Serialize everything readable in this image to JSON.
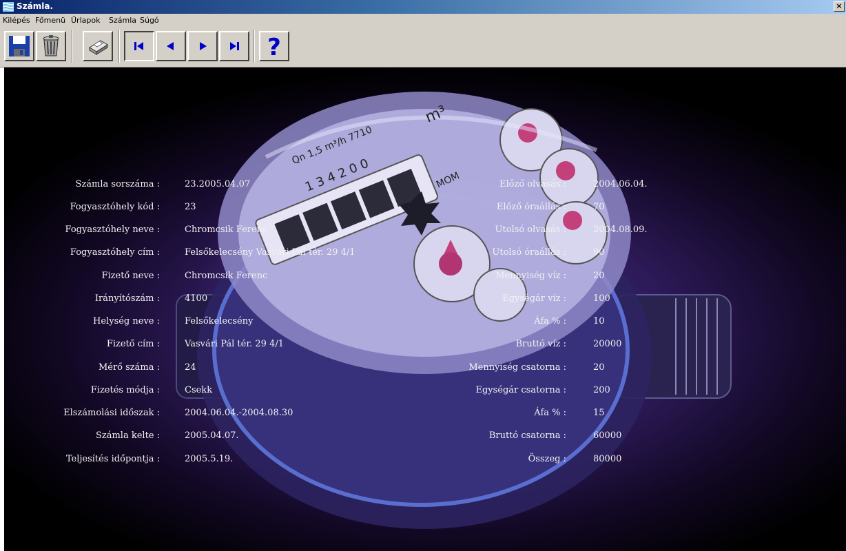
{
  "window": {
    "title": "Számla.",
    "close_glyph": "×"
  },
  "menu": [
    "Kilépés",
    "Főmenü",
    "Űrlapok",
    "Számla",
    "Súgó"
  ],
  "toolbar": {
    "buttons": [
      {
        "name": "save-button",
        "icon": "floppy-disk-icon"
      },
      {
        "name": "delete-button",
        "icon": "trash-can-icon"
      },
      {
        "name": "print-button",
        "icon": "printer-icon"
      },
      {
        "name": "first-record-button",
        "icon": "skip-first-icon"
      },
      {
        "name": "previous-record-button",
        "icon": "arrow-left-icon"
      },
      {
        "name": "next-record-button",
        "icon": "arrow-right-icon"
      },
      {
        "name": "last-record-button",
        "icon": "skip-last-icon"
      },
      {
        "name": "help-button",
        "icon": "question-mark-icon",
        "glyph": "?"
      }
    ],
    "nav_color": "#0000cc",
    "help_color": "#0000cc"
  },
  "invoice": {
    "left": [
      {
        "label": "Számla sorszáma :",
        "value": "23.2005.04.07"
      },
      {
        "label": "Fogyasztóhely kód :",
        "value": "23"
      },
      {
        "label": "Fogyasztóhely neve :",
        "value": "Chromcsik Ferenc"
      },
      {
        "label": "Fogyasztóhely cím :",
        "value": "Felsőkelecsény  Vasvári Pál tér.  29  4/1"
      },
      {
        "label": "Fizető neve :",
        "value": "Chromcsik Ferenc"
      },
      {
        "label": "Irányítószám :",
        "value": "4100"
      },
      {
        "label": "Helység neve :",
        "value": "Felsőkelecsény"
      },
      {
        "label": "Fizető cím :",
        "value": "Vasvári Pál tér.  29  4/1"
      },
      {
        "label": "Mérő száma :",
        "value": "24"
      },
      {
        "label": "Fizetés módja :",
        "value": "Csekk"
      },
      {
        "label": "Elszámolási időszak :",
        "value": "2004.06.04.-2004.08.30"
      },
      {
        "label": "Számla kelte :",
        "value": "2005.04.07."
      },
      {
        "label": "Teljesítés időpontja :",
        "value": "2005.5.19."
      }
    ],
    "right": [
      {
        "label": "Előző olvasás :",
        "value": "2004.06.04."
      },
      {
        "label": "Előző óraállás :",
        "value": "70"
      },
      {
        "label": "Utolsó olvasás :",
        "value": "2004.08.09."
      },
      {
        "label": "Utolsó óraállás :",
        "value": "90"
      },
      {
        "label": "Mennyiség víz :",
        "value": "20"
      },
      {
        "label": "Egységár víz :",
        "value": "100"
      },
      {
        "label": "Áfa % :",
        "value": "10"
      },
      {
        "label": "Bruttó víz :",
        "value": "20000"
      },
      {
        "label": "Mennyiség csatorna :",
        "value": "20"
      },
      {
        "label": "Egységár csatorna :",
        "value": "200"
      },
      {
        "label": "Áfa % :",
        "value": "15"
      },
      {
        "label": "Bruttó csatorna :",
        "value": "60000"
      },
      {
        "label": "Összeg :",
        "value": "80000"
      }
    ]
  },
  "background": {
    "meter_dial_text": [
      "1 3 4 2 0 0",
      "Qn 1,5 m³/h  7710",
      "m³",
      "MOM"
    ]
  }
}
